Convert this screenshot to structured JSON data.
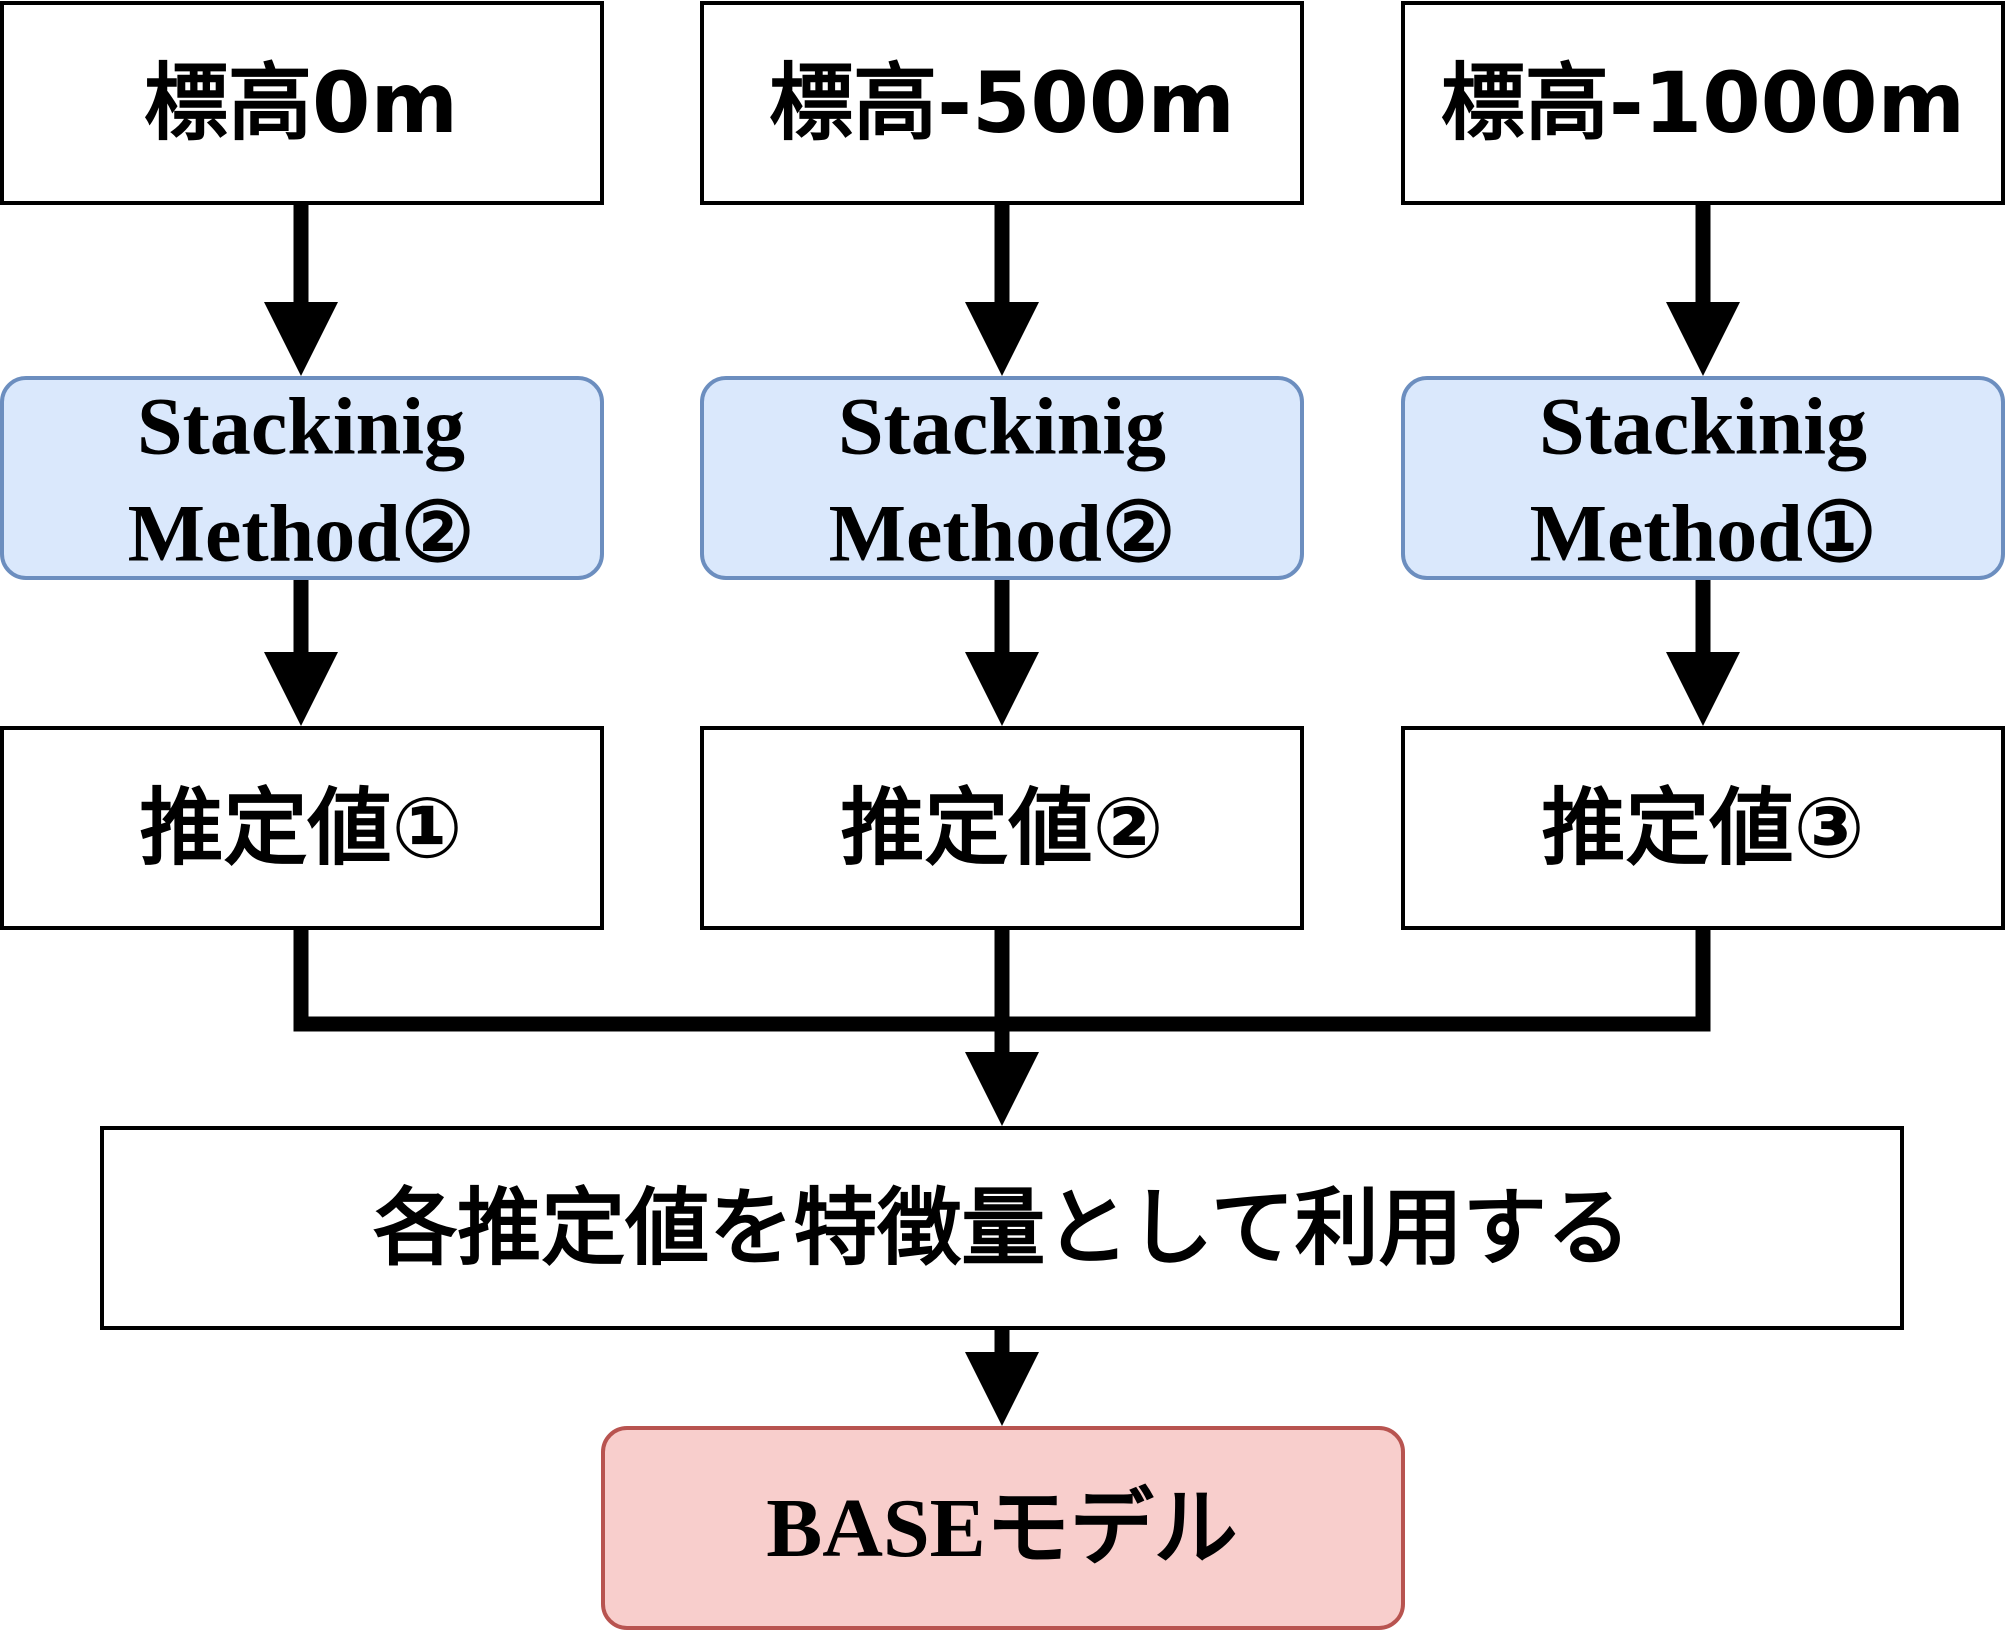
{
  "inputs": [
    {
      "label": "標高0m"
    },
    {
      "label": "標高-500m"
    },
    {
      "label": "標高-1000m"
    }
  ],
  "methods": [
    {
      "line1": "Stackinig",
      "line2": "Method②"
    },
    {
      "line1": "Stackinig",
      "line2": "Method②"
    },
    {
      "line1": "Stackinig",
      "line2": "Method①"
    }
  ],
  "estimates": [
    {
      "label": "推定値①"
    },
    {
      "label": "推定値②"
    },
    {
      "label": "推定値③"
    }
  ],
  "combine": {
    "label": "各推定値を特徴量として利用する"
  },
  "base": {
    "prefix": "BASE",
    "suffix": "モデル"
  },
  "colors": {
    "stack_fill": "#dae8fc",
    "stack_stroke": "#6c8ebf",
    "base_fill": "#f8cecc",
    "base_stroke": "#b85450"
  }
}
